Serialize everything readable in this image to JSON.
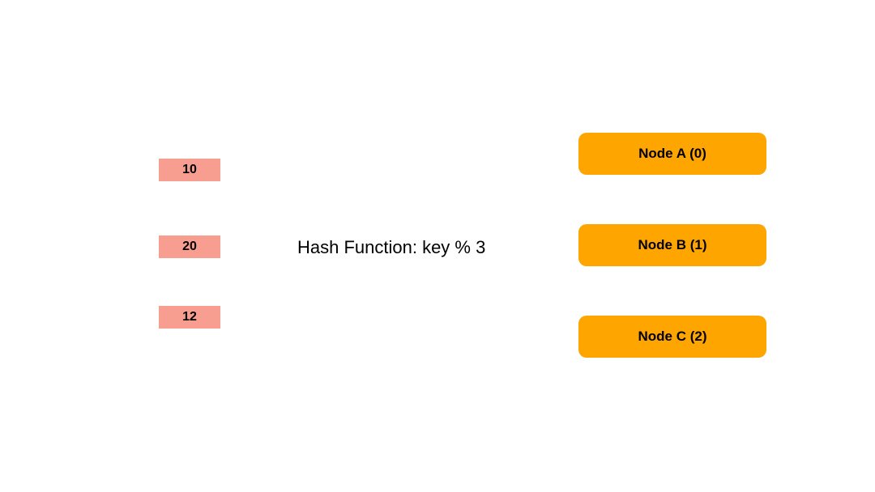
{
  "keys": [
    {
      "label": "10"
    },
    {
      "label": "20"
    },
    {
      "label": "12"
    }
  ],
  "hashFunction": {
    "label": "Hash Function: key %  3"
  },
  "nodes": [
    {
      "label": "Node A (0)"
    },
    {
      "label": "Node B (1)"
    },
    {
      "label": "Node C (2)"
    }
  ]
}
